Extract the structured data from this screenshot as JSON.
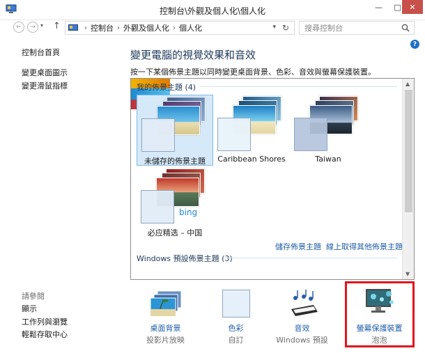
{
  "window": {
    "title": "控制台\\外觀及個人化\\個人化",
    "minimize": "—",
    "maximize": "□",
    "close": "✕"
  },
  "address_bar": {
    "back": "←",
    "forward": "→",
    "up": "↑",
    "crumbs": [
      "控制台",
      "外觀及個人化",
      "個人化"
    ],
    "separator": "›",
    "refresh": "↻",
    "search_placeholder": "搜尋控制台"
  },
  "left_pane": {
    "links": [
      "控制台首頁",
      "變更桌面圖示",
      "變更滑鼠指標"
    ],
    "see_also_title": "請參閱",
    "see_also": [
      "顯示",
      "工作列與瀏覽",
      "輕鬆存取中心"
    ]
  },
  "main": {
    "heading": "變更電腦的視覺效果和音效",
    "subtext": "按一下某個佈景主題以同時變更桌面背景、色彩、音效與螢幕保護裝置。",
    "my_themes_title": "我的佈景主題 (4)",
    "themes": [
      {
        "label": "未儲存的佈景主題",
        "selected": true
      },
      {
        "label": "Caribbean Shores",
        "selected": false
      },
      {
        "label": "Taiwan",
        "selected": false
      },
      {
        "label": "必应精选 – 中国",
        "selected": false
      }
    ],
    "save_theme_link": "儲存佈景主題",
    "get_more_link": "線上取得其他佈景主題",
    "windows_themes_title": "Windows 預設佈景主題 (3)"
  },
  "bottom": {
    "tiles": [
      {
        "name": "桌面背景",
        "value": "投影片放映"
      },
      {
        "name": "色彩",
        "value": "自訂"
      },
      {
        "name": "音效",
        "value": "Windows 預設"
      },
      {
        "name": "螢幕保護裝置",
        "value": "泡泡"
      }
    ]
  },
  "colors": {
    "accent_link": "#1f5ea8",
    "heading": "#1e395b",
    "close_button": "#c7504a",
    "highlight_box": "#e3131b",
    "selection": "#d6e9f8"
  },
  "icons": {
    "control_panel": "control-panel-icon",
    "search": "search-icon",
    "help": "help-icon",
    "bing_logo": "bing"
  }
}
